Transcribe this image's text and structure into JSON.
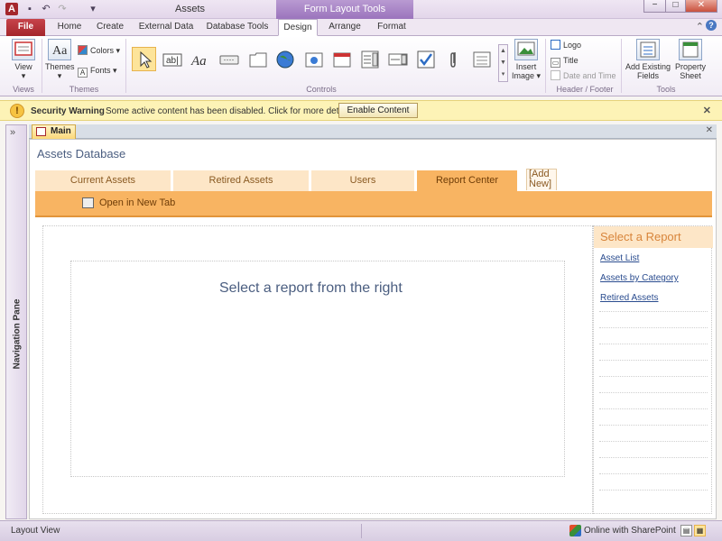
{
  "window": {
    "title": "Assets",
    "context_tools": "Form Layout Tools",
    "app_letter": "A",
    "minimize": "−",
    "restore": "□",
    "close": "✕"
  },
  "ribbon_tabs": [
    "File",
    "Home",
    "Create",
    "External Data",
    "Database Tools",
    "Design",
    "Arrange",
    "Format"
  ],
  "ribbon": {
    "views": {
      "view_label": "View",
      "group": "Views"
    },
    "themes": {
      "themes_label": "Themes",
      "colors_label": "Colors",
      "fonts_label": "Fonts",
      "group": "Themes"
    },
    "controls": {
      "group": "Controls"
    },
    "insert_image": {
      "line1": "Insert",
      "line2": "Image"
    },
    "header_footer": {
      "logo": "Logo",
      "title": "Title",
      "date_time": "Date and Time",
      "group": "Header / Footer"
    },
    "tools": {
      "add_fields_1": "Add Existing",
      "add_fields_2": "Fields",
      "prop_1": "Property",
      "prop_2": "Sheet",
      "group": "Tools"
    }
  },
  "security_bar": {
    "title": "Security Warning",
    "message": "Some active content has been disabled. Click for more details.",
    "button": "Enable Content",
    "close": "✕"
  },
  "nav_pane": {
    "label": "Navigation Pane",
    "toggle": "»"
  },
  "doc_tab": {
    "label": "Main",
    "close": "✕"
  },
  "form": {
    "title": "Assets Database",
    "tabs": [
      "Current Assets",
      "Retired Assets",
      "Users",
      "Report Center"
    ],
    "add_new": "[Add New]",
    "open_new_tab": "Open in New Tab",
    "placeholder": "Select a report from the right",
    "report_header": "Select a Report",
    "reports": [
      "Asset List",
      "Assets by Category",
      "Retired Assets"
    ]
  },
  "status_bar": {
    "view": "Layout View",
    "sharepoint": "Online with SharePoint"
  },
  "colors": {
    "accent_orange": "#f8b462",
    "light_orange": "#fde6c7",
    "title_blue": "#4b5e80",
    "file_red": "#a4262c",
    "warning_yellow": "#fdf3b6"
  }
}
